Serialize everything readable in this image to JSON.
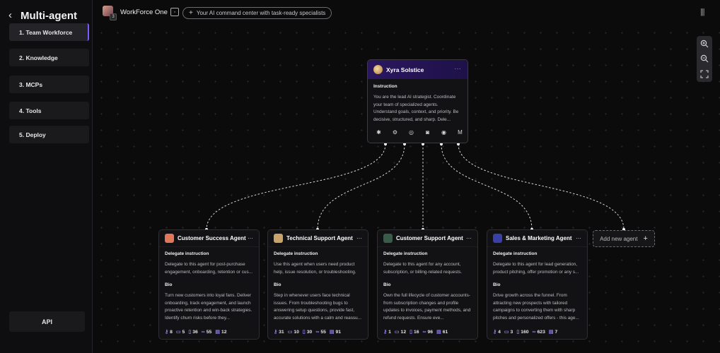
{
  "sidebar": {
    "title": "Multi-agent",
    "steps": [
      "1. Team Workforce",
      "2. Knowledge",
      "3. MCPs",
      "4. Tools",
      "5. Deploy"
    ],
    "api_label": "API"
  },
  "topbar": {
    "workspace_name": "WorkForce One",
    "workspace_badge": "3",
    "tagline": "Your AI command center with task-ready specialists"
  },
  "root_agent": {
    "name": "Xyra Solstice",
    "instruction_label": "Instruction",
    "instruction": "You are the lead AI strategist. Coordinate your team of specialized agents. Understand goals, context, and priority. Be decisive, structured, and sharp. Dele...",
    "integrations": [
      "slack-icon",
      "hubspot-icon",
      "whatsapp-icon",
      "discord-icon",
      "messenger-icon",
      "gmail-icon"
    ]
  },
  "agents": [
    {
      "name": "Customer Success Agent",
      "delegate_label": "Delegate instruction",
      "delegate": "Delegate to this agent for post-purchase engagement, onboarding, retention or cus...",
      "bio_label": "Bio",
      "bio": "Turn new customers into loyal fans. Deliver onboarding, track engagement, and launch proactive retention and win-back strategies. Identify churn risks before they...",
      "stats": [
        "8",
        "5",
        "36",
        "55",
        "12"
      ],
      "avatar_color": "#e0765a"
    },
    {
      "name": "Technical Support Agent",
      "delegate_label": "Delegate instruction",
      "delegate": "Use this agent when users need product help, issue resolution, or troubleshooting. I...",
      "bio_label": "Bio",
      "bio": "Step in whenever users face technical issues. From troubleshooting bugs to answering setup questions, provide fast, accurate solutions with a calm and reassu...",
      "stats": [
        "31",
        "10",
        "30",
        "55",
        "91"
      ],
      "avatar_color": "#c9a46a"
    },
    {
      "name": "Customer Support Agent",
      "delegate_label": "Delegate instruction",
      "delegate": "Delegate to this agent for any account, subscription, or billing-related requests.",
      "bio_label": "Bio",
      "bio": "Own the full lifecycle of customer accounts-from subscription changes and profile updates to invoices, payment methods, and refund requests. Ensure eve...",
      "stats": [
        "1",
        "12",
        "16",
        "96",
        "61"
      ],
      "avatar_color": "#3a5a4a"
    },
    {
      "name": "Sales & Marketing Agent",
      "delegate_label": "Delegate instruction",
      "delegate": "Delegate to this agent for lead generation, product pitching, offer promotion or any s...",
      "bio_label": "Bio",
      "bio": "Drive growth across the funnel. From attracting new prospects with tailored campaigns to converting them with sharp pitches and personalized offers - this age...",
      "stats": [
        "4",
        "3",
        "160",
        "623",
        "7"
      ],
      "avatar_color": "#3b3fa8"
    }
  ],
  "add_agent_label": "Add new agent"
}
